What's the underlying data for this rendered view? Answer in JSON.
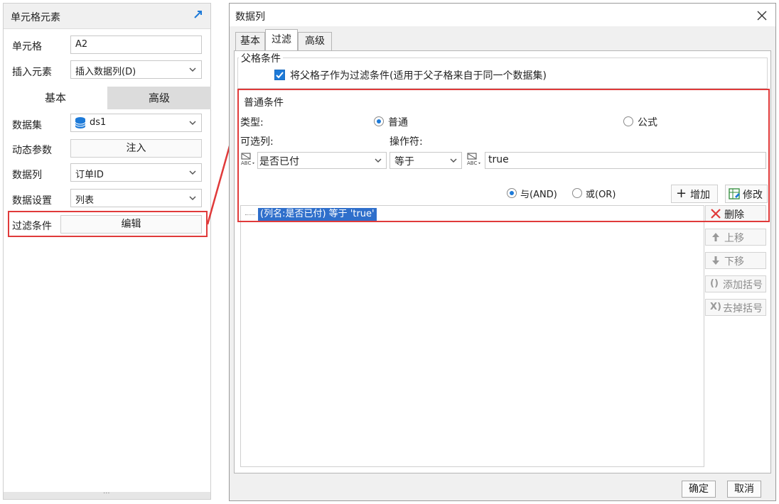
{
  "left_panel": {
    "title": "单元格元素",
    "rows": {
      "cell_label": "单元格",
      "cell_value": "A2",
      "insert_label": "插入元素",
      "insert_value": "插入数据列(D)",
      "dataset_label": "数据集",
      "dataset_value": "ds1",
      "param_label": "动态参数",
      "param_button": "注入",
      "column_label": "数据列",
      "column_value": "订单ID",
      "setting_label": "数据设置",
      "setting_value": "列表",
      "filter_label": "过滤条件",
      "filter_button": "编辑"
    },
    "tabs": [
      "基本",
      "高级"
    ],
    "icons": {
      "pin": "pin-arrow-icon",
      "dataset": "database-icon",
      "chevron": "chevron-down-icon"
    }
  },
  "dialog": {
    "title": "数据列",
    "tabs": [
      "基本",
      "过滤",
      "高级"
    ],
    "active_tab": "过滤",
    "parent_group": {
      "legend": "父格条件",
      "checkbox_label": "将父格子作为过滤条件(适用于父子格来自于同一个数据集)",
      "checked": true
    },
    "normal_group": {
      "legend": "普通条件",
      "type_label": "类型:",
      "radio_normal": "普通",
      "radio_formula": "公式",
      "selected_type": "普通",
      "column_label": "可选列:",
      "operator_label": "操作符:",
      "column_value": "是否已付",
      "operator_value": "等于",
      "value_text": "true",
      "and_label": "与(AND)",
      "or_label": "或(OR)",
      "selected_logic": "与(AND)",
      "add_button": "增加",
      "modify_button": "修改"
    },
    "conditions": [
      "(列名:是否已付) 等于 'true'"
    ],
    "side_buttons": {
      "delete": "删除",
      "move_up": "上移",
      "move_down": "下移",
      "add_bracket": "添加括号",
      "remove_bracket": "去掉括号"
    },
    "ok_button": "确定",
    "cancel_button": "取消"
  },
  "colors": {
    "highlight_red": "#e03a3a",
    "accent_blue": "#1d7ad8",
    "selection_blue": "#2f6fcb"
  }
}
